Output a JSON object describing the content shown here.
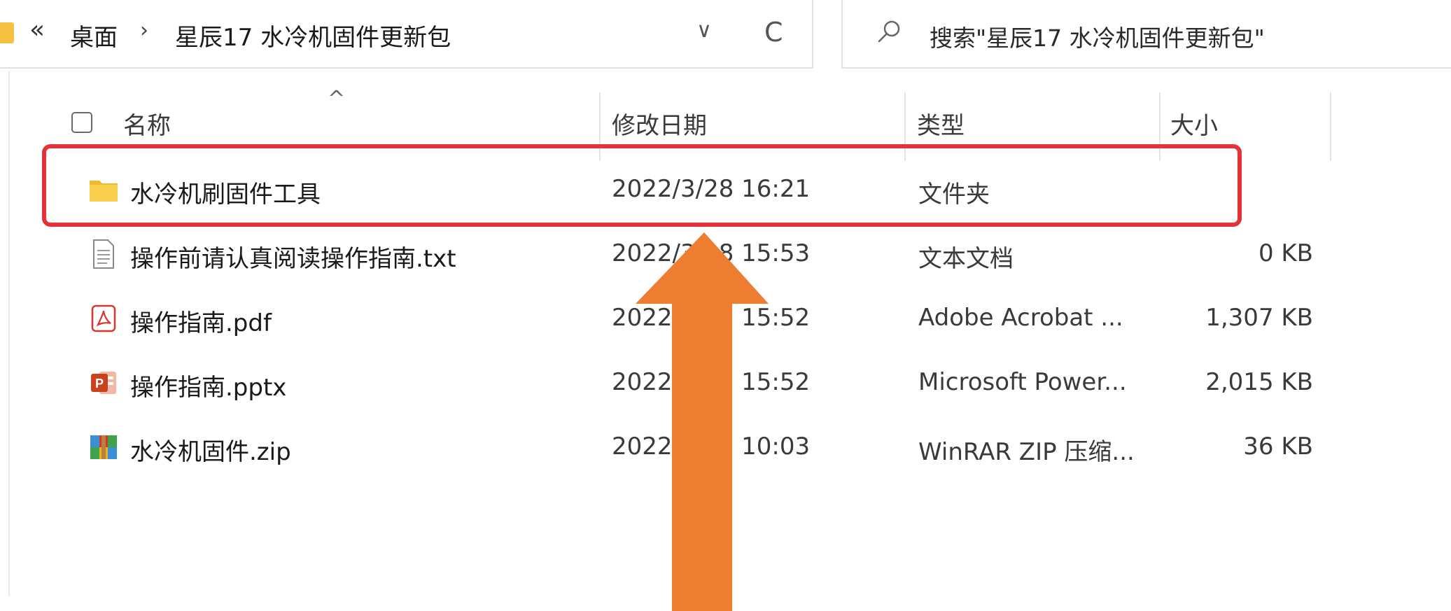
{
  "address_bar": {
    "overflow_glyph": "«",
    "breadcrumb": [
      "桌面",
      "星辰17 水冷机固件更新包"
    ],
    "separator": "›",
    "dropdown_glyph": "∨",
    "refresh_glyph": "C"
  },
  "search": {
    "placeholder": "搜索\"星辰17 水冷机固件更新包\""
  },
  "columns": {
    "name": "名称",
    "date": "修改日期",
    "type": "类型",
    "size": "大小"
  },
  "files": [
    {
      "icon": "folder-icon",
      "name": "水冷机刷固件工具",
      "date": "2022/3/28 16:21",
      "type": "文件夹",
      "size": ""
    },
    {
      "icon": "text-file-icon",
      "name": "操作前请认真阅读操作指南.txt",
      "date": "2022/3/28 15:53",
      "type": "文本文档",
      "size": "0 KB"
    },
    {
      "icon": "pdf-icon",
      "name": "操作指南.pdf",
      "date": "2022/3/28 15:52",
      "type": "Adobe Acrobat ...",
      "size": "1,307 KB"
    },
    {
      "icon": "pptx-icon",
      "name": "操作指南.pptx",
      "date": "2022/3/28 15:52",
      "type": "Microsoft Power...",
      "size": "2,015 KB"
    },
    {
      "icon": "winrar-icon",
      "name": "水冷机固件.zip",
      "date": "2022/3/25 10:03",
      "type": "WinRAR ZIP 压缩...",
      "size": "36 KB"
    }
  ],
  "colors": {
    "highlight_box": "#e53238",
    "arrow": "#ed7d31",
    "folder": "#f4c142"
  }
}
